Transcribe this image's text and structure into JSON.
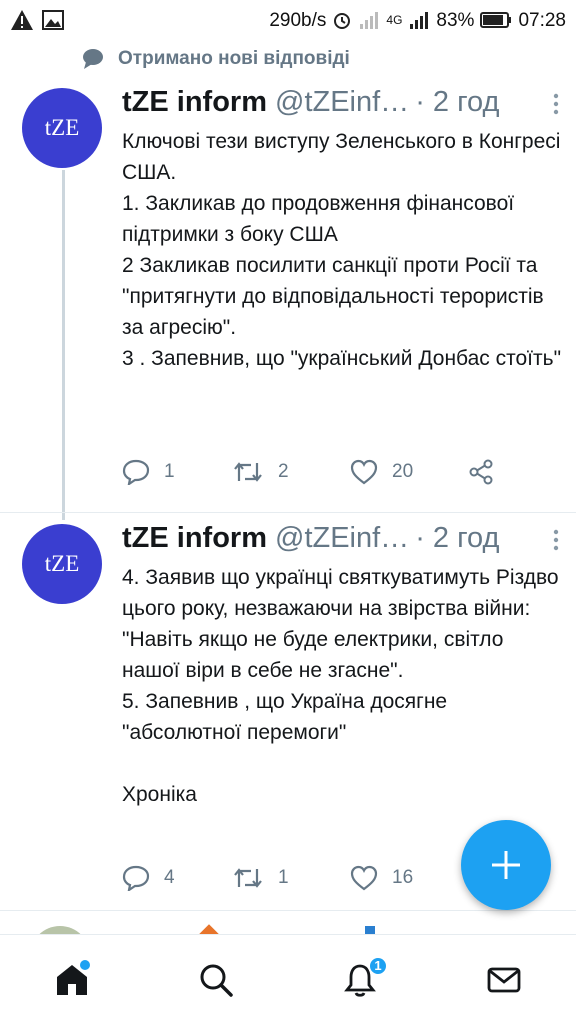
{
  "status_bar": {
    "net_speed": "290b/s",
    "network": "4G",
    "battery": "83%",
    "time": "07:28"
  },
  "notice": {
    "text": "Отримано нові відповіді",
    "icon": "speech-bubble-icon"
  },
  "tweets": [
    {
      "avatar_text": "tZE",
      "name": "tZE inform",
      "handle": "@tZEinf…",
      "time": "· 2 год",
      "text": "Ключові тези виступу Зеленського в Конгресі США.\n1. Закликав до продовження фінансової підтримки з боку США\n2 Закликав  посилити санкції проти Росії та \"притягнути до відповідальності терористів за агресію\".\n3 . Запевнив, що \"український Донбас стоїть\"",
      "replies": "1",
      "retweets": "2",
      "likes": "20"
    },
    {
      "avatar_text": "tZE",
      "name": "tZE inform",
      "handle": "@tZEinf…",
      "time": "· 2 год",
      "text": "4. Заявив що українці святкуватимуть Різдво цього року, незважаючи на звірства війни: \"Навіть якщо не буде електрики, світло нашої віри в себе не згасне\".\n5. Запевнив , що Україна досягне \"абсолютної перемоги\"\n\nХроніка",
      "replies": "4",
      "retweets": "1",
      "likes": "16"
    }
  ],
  "nav": {
    "notifications_badge": "1"
  },
  "colors": {
    "accent": "#1da1f2",
    "avatar_bg": "#3a3ed0",
    "muted": "#657786"
  }
}
